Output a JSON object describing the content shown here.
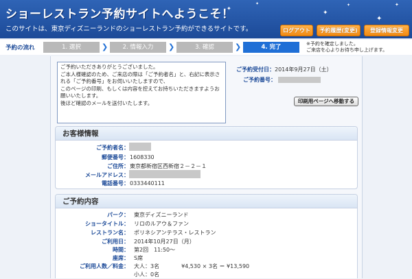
{
  "header": {
    "title": "ショーレストラン予約サイトへようこそ！",
    "subtitle": "このサイトは、東京ディズニーランドのショーレストラン予約ができるサイトです。",
    "buttons": [
      "ログアウト",
      "予約履歴(変更)",
      "登録情報変更"
    ]
  },
  "steps": {
    "flow_label": "予約の流れ",
    "items": [
      "1. 選択",
      "2. 情報入力",
      "3. 確認",
      "4. 完了"
    ],
    "note": "※予約を確定しました。\nご来店を心よりお待ち申し上げます。"
  },
  "message": "ご予約いただきありがとうございました。\nご本人様確認のため、ご来店の際は「ご予約者名」と、右記に表示される「ご予約番号」をお伺いいたしますので、\nこのページの印刷、もしくは内容を控えてお持ちいただきますようお願いいたします。\n後ほど確認のメールを送付いたします。",
  "reservation": {
    "date_label": "ご予約受付日：",
    "date_value": "2014年9月27日（土）",
    "number_label": "ご予約番号："
  },
  "print_button": "印刷用ページへ移動する",
  "customer": {
    "heading": "お客様情報",
    "fields": [
      {
        "label": "ご予約者名：",
        "value": ""
      },
      {
        "label": "郵便番号：",
        "value": "1608330"
      },
      {
        "label": "ご住所：",
        "value": "東京都新宿区西新宿２－２－１"
      },
      {
        "label": "メールアドレス：",
        "value": ""
      },
      {
        "label": "電話番号：",
        "value": "0333440111"
      }
    ]
  },
  "booking": {
    "heading": "ご予約内容",
    "fields": [
      {
        "label": "パーク：",
        "value": "東京ディズニーランド"
      },
      {
        "label": "ショータイトル：",
        "value": "リロのルアウ＆ファン"
      },
      {
        "label": "レストラン名：",
        "value": "ポリネシアンテラス・レストラン"
      },
      {
        "label": "ご利用日：",
        "value": "2014年10月27日（月）"
      },
      {
        "label": "時間：",
        "value": "第2回　11:50～"
      },
      {
        "label": "座席：",
        "value": "S席"
      },
      {
        "label": "ご利用人数／料金：",
        "value": "大人：3名　　　　¥4,530 × 3名 ＝ ¥13,590"
      },
      {
        "label": "",
        "value": "小人：0名"
      }
    ]
  },
  "colors": {
    "header": "#1c4a98",
    "accent_button": "#f28a12",
    "active_step": "#1f6fd6"
  }
}
